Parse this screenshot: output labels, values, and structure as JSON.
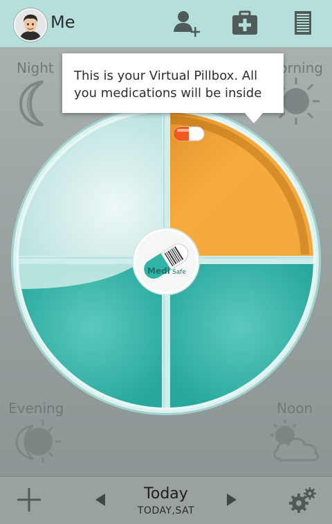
{
  "header": {
    "user_name": "Me",
    "avatar_icon": "user-avatar",
    "add_person_icon": "add-person-icon",
    "medkit_icon": "medkit-icon",
    "list_icon": "list-icon"
  },
  "corners": {
    "night": "Night",
    "morning": "Morning",
    "evening": "Evening",
    "noon": "Noon"
  },
  "tooltip": {
    "text": "This is your Virtual Pillbox. All you medications will be inside"
  },
  "pillbox": {
    "logo_text_medi": "Medi",
    "logo_text_safe": "Safe",
    "morning_color": "#f5a63c",
    "teal_color": "#35b8ad",
    "light_color": "#d8efee",
    "pill_colors": [
      "#f05a1e",
      "#ffffff"
    ]
  },
  "footer": {
    "add_icon": "plus-icon",
    "prev_icon": "chevron-left-icon",
    "next_icon": "chevron-right-icon",
    "date_title": "Today",
    "date_sub": "TODAY,SAT",
    "settings_icon": "gears-icon"
  }
}
